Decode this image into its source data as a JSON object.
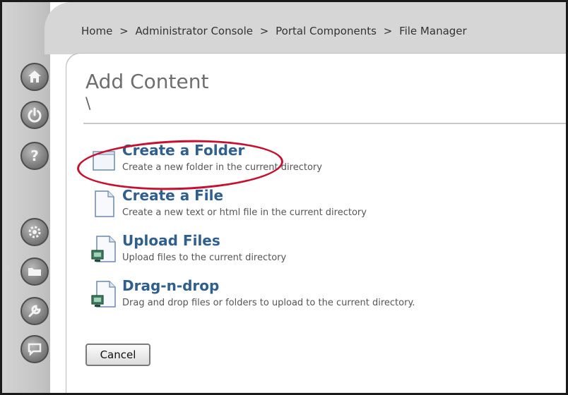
{
  "breadcrumb": {
    "items": [
      "Home",
      "Administrator Console",
      "Portal Components",
      "File Manager"
    ],
    "separator": ">"
  },
  "header": {
    "title": "Add Content",
    "path": "\\"
  },
  "rail": {
    "buttons": [
      {
        "icon": "home-icon"
      },
      {
        "icon": "power-icon"
      },
      {
        "icon": "help-icon"
      },
      {
        "icon": "gear-icon"
      },
      {
        "icon": "folder-icon"
      },
      {
        "icon": "wrench-icon"
      },
      {
        "icon": "chat-icon"
      }
    ]
  },
  "actions": [
    {
      "title": "Create a Folder",
      "desc": "Create a new folder in the current directory",
      "icon": "folder-doc-icon"
    },
    {
      "title": "Create a File",
      "desc": "Create a new text or html file in the current directory",
      "icon": "file-icon"
    },
    {
      "title": "Upload Files",
      "desc": "Upload files to the current directory",
      "icon": "upload-icon"
    },
    {
      "title": "Drag-n-drop",
      "desc": "Drag and drop files or folders to upload to the current directory.",
      "icon": "drag-drop-icon"
    }
  ],
  "cancel_label": "Cancel",
  "colors": {
    "link": "#2f5f8e",
    "highlight": "#c8102e",
    "rail": "#c6c6c6"
  }
}
